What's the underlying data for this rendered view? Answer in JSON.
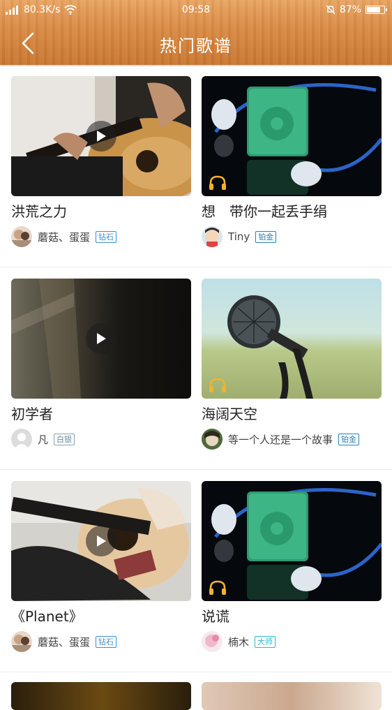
{
  "status": {
    "network_speed": "80.3K/s",
    "time": "09:58",
    "battery": "87%",
    "battery_level": 0.87
  },
  "header": {
    "title": "热门歌谱"
  },
  "cards": [
    {
      "title": "洪荒之力",
      "author": "蘑菇、蛋蛋",
      "badge": "钻石",
      "type": "video",
      "art": "guitar-warm"
    },
    {
      "title": "想　带你一起丢手绢",
      "author": "Tiny",
      "badge": "铂金",
      "type": "audio",
      "art": "ipod"
    },
    {
      "title": "初学者",
      "author": "凡",
      "badge": "白银",
      "type": "video",
      "art": "dark"
    },
    {
      "title": "海阔天空",
      "author": "等一个人还是一个故事",
      "badge": "铂金",
      "type": "audio",
      "art": "mic"
    },
    {
      "title": "《Planet》",
      "author": "蘑菇、蛋蛋",
      "badge": "钻石",
      "type": "video",
      "art": "guitar-light"
    },
    {
      "title": "说谎",
      "author": "楠木",
      "badge": "大师",
      "type": "audio",
      "art": "ipod"
    }
  ],
  "colors": {
    "header": "#d98a43",
    "diamond": "#3b8fd0",
    "platinum": "#2a7fb2",
    "silver": "#8aa3b5",
    "master": "#2fb7d2",
    "headphone": "#f1b32c"
  }
}
